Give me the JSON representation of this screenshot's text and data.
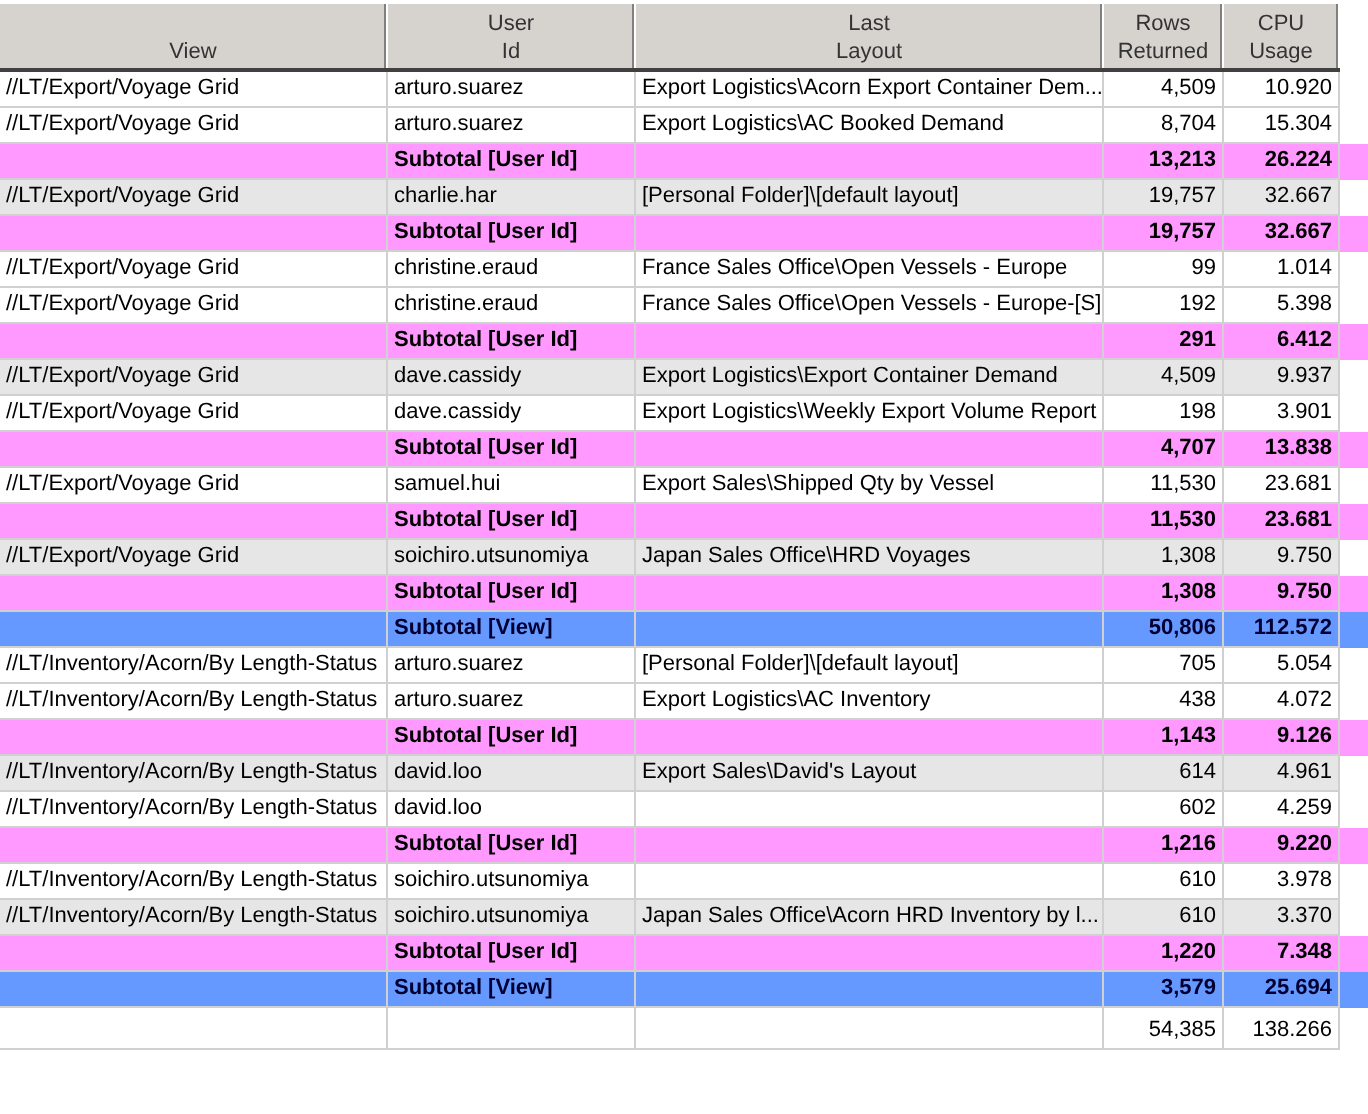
{
  "table": {
    "columns": [
      {
        "lines": [
          "View"
        ]
      },
      {
        "lines": [
          "User",
          "Id"
        ]
      },
      {
        "lines": [
          "Last",
          "Layout"
        ]
      },
      {
        "lines": [
          "Rows",
          "Returned"
        ]
      },
      {
        "lines": [
          "CPU",
          "Usage"
        ]
      }
    ],
    "rows": [
      {
        "kind": "data",
        "shaded": false,
        "cells": [
          "//LT/Export/Voyage Grid",
          "arturo.suarez",
          "Export Logistics\\Acorn Export Container Dem...",
          "4,509",
          "10.920"
        ]
      },
      {
        "kind": "data",
        "shaded": false,
        "cells": [
          "//LT/Export/Voyage Grid",
          "arturo.suarez",
          "Export Logistics\\AC Booked Demand",
          "8,704",
          "15.304"
        ]
      },
      {
        "kind": "subtotal_user",
        "cells": [
          "",
          "Subtotal [User Id]",
          "",
          "13,213",
          "26.224"
        ]
      },
      {
        "kind": "data",
        "shaded": true,
        "cells": [
          "//LT/Export/Voyage Grid",
          "charlie.har",
          "[Personal Folder]\\[default layout]",
          "19,757",
          "32.667"
        ]
      },
      {
        "kind": "subtotal_user",
        "cells": [
          "",
          "Subtotal [User Id]",
          "",
          "19,757",
          "32.667"
        ]
      },
      {
        "kind": "data",
        "shaded": false,
        "cells": [
          "//LT/Export/Voyage Grid",
          "christine.eraud",
          "France Sales Office\\Open Vessels - Europe",
          "99",
          "1.014"
        ]
      },
      {
        "kind": "data",
        "shaded": false,
        "cells": [
          "//LT/Export/Voyage Grid",
          "christine.eraud",
          "France Sales Office\\Open Vessels - Europe-[S]",
          "192",
          "5.398"
        ]
      },
      {
        "kind": "subtotal_user",
        "cells": [
          "",
          "Subtotal [User Id]",
          "",
          "291",
          "6.412"
        ]
      },
      {
        "kind": "data",
        "shaded": true,
        "cells": [
          "//LT/Export/Voyage Grid",
          "dave.cassidy",
          "Export Logistics\\Export Container Demand",
          "4,509",
          "9.937"
        ]
      },
      {
        "kind": "data",
        "shaded": false,
        "cells": [
          "//LT/Export/Voyage Grid",
          "dave.cassidy",
          "Export Logistics\\Weekly Export Volume Report",
          "198",
          "3.901"
        ]
      },
      {
        "kind": "subtotal_user",
        "cells": [
          "",
          "Subtotal [User Id]",
          "",
          "4,707",
          "13.838"
        ]
      },
      {
        "kind": "data",
        "shaded": false,
        "cells": [
          "//LT/Export/Voyage Grid",
          "samuel.hui",
          "Export Sales\\Shipped Qty by Vessel",
          "11,530",
          "23.681"
        ]
      },
      {
        "kind": "subtotal_user",
        "cells": [
          "",
          "Subtotal [User Id]",
          "",
          "11,530",
          "23.681"
        ]
      },
      {
        "kind": "data",
        "shaded": true,
        "cells": [
          "//LT/Export/Voyage Grid",
          "soichiro.utsunomiya",
          "Japan Sales Office\\HRD Voyages",
          "1,308",
          "9.750"
        ]
      },
      {
        "kind": "subtotal_user",
        "cells": [
          "",
          "Subtotal [User Id]",
          "",
          "1,308",
          "9.750"
        ]
      },
      {
        "kind": "subtotal_view",
        "cells": [
          "",
          "Subtotal [View]",
          "",
          "50,806",
          "112.572"
        ]
      },
      {
        "kind": "data",
        "shaded": false,
        "cells": [
          "//LT/Inventory/Acorn/By Length-Status",
          "arturo.suarez",
          "[Personal Folder]\\[default layout]",
          "705",
          "5.054"
        ]
      },
      {
        "kind": "data",
        "shaded": false,
        "cells": [
          "//LT/Inventory/Acorn/By Length-Status",
          "arturo.suarez",
          "Export Logistics\\AC Inventory",
          "438",
          "4.072"
        ]
      },
      {
        "kind": "subtotal_user",
        "cells": [
          "",
          "Subtotal [User Id]",
          "",
          "1,143",
          "9.126"
        ]
      },
      {
        "kind": "data",
        "shaded": true,
        "cells": [
          "//LT/Inventory/Acorn/By Length-Status",
          "david.loo",
          "Export Sales\\David's Layout",
          "614",
          "4.961"
        ]
      },
      {
        "kind": "data",
        "shaded": false,
        "cells": [
          "//LT/Inventory/Acorn/By Length-Status",
          "david.loo",
          "",
          "602",
          "4.259"
        ]
      },
      {
        "kind": "subtotal_user",
        "cells": [
          "",
          "Subtotal [User Id]",
          "",
          "1,216",
          "9.220"
        ]
      },
      {
        "kind": "data",
        "shaded": false,
        "cells": [
          "//LT/Inventory/Acorn/By Length-Status",
          "soichiro.utsunomiya",
          "",
          "610",
          "3.978"
        ]
      },
      {
        "kind": "data",
        "shaded": true,
        "cells": [
          "//LT/Inventory/Acorn/By Length-Status",
          "soichiro.utsunomiya",
          "Japan Sales Office\\Acorn HRD Inventory by l...",
          "610",
          "3.370"
        ]
      },
      {
        "kind": "subtotal_user",
        "cells": [
          "",
          "Subtotal [User Id]",
          "",
          "1,220",
          "7.348"
        ]
      },
      {
        "kind": "subtotal_view",
        "cells": [
          "",
          "Subtotal [View]",
          "",
          "3,579",
          "25.694"
        ]
      },
      {
        "kind": "total",
        "cells": [
          "",
          "",
          "",
          "54,385",
          "138.266"
        ]
      }
    ]
  }
}
